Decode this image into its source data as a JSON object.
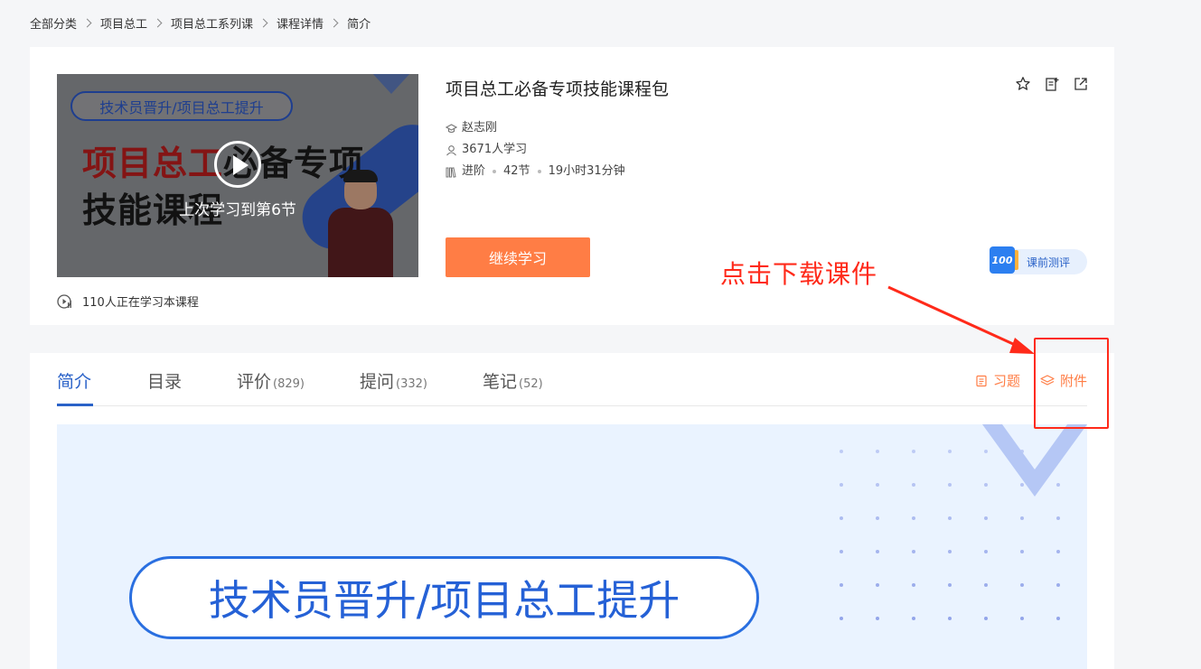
{
  "breadcrumb": [
    "全部分类",
    "项目总工",
    "项目总工系列课",
    "课程详情",
    "简介"
  ],
  "thumbnail": {
    "pill_text": "技术员晋升/项目总工提升",
    "title_line1_red": "项目总工",
    "title_line1_dark": "必备专项",
    "title_line2": "技能课程",
    "last_study": "上次学习到第6节"
  },
  "learners_now": "110人正在学习本课程",
  "course": {
    "title": "项目总工必备专项技能课程包",
    "teacher": "赵志刚",
    "students": "3671人学习",
    "level": "进阶",
    "lessons": "42节",
    "duration": "19小时31分钟"
  },
  "continue_button": "继续学习",
  "pretest_label": "课前测评",
  "pretest_badge": "100",
  "annotation": "点击下载课件",
  "tabs": [
    {
      "label": "简介",
      "count": ""
    },
    {
      "label": "目录",
      "count": ""
    },
    {
      "label": "评价",
      "count": "(829)"
    },
    {
      "label": "提问",
      "count": "(332)"
    },
    {
      "label": "笔记",
      "count": "(52)"
    }
  ],
  "tools": {
    "exercise": "习题",
    "attachment": "附件"
  },
  "banner_text": "技术员晋升/项目总工提升",
  "colors": {
    "accent": "#2a62c8",
    "orange": "#ff7d45",
    "annotation": "#ff2a1a"
  }
}
